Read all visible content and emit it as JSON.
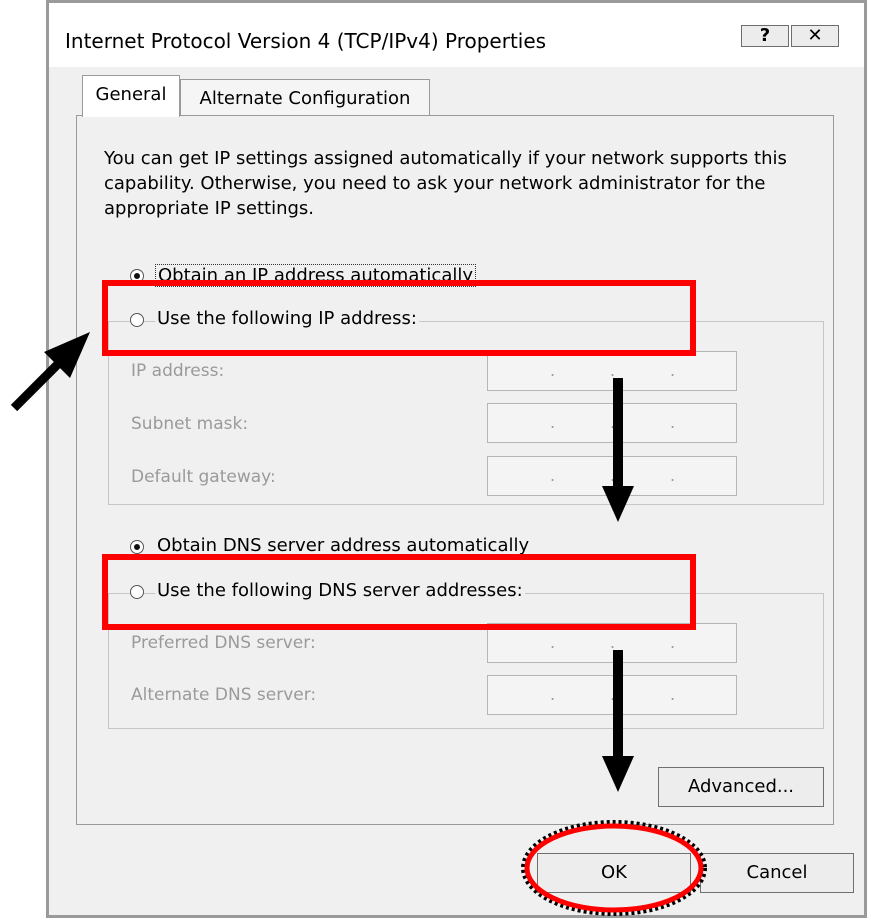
{
  "window": {
    "title": "Internet Protocol Version 4 (TCP/IPv4) Properties",
    "help_label": "?",
    "close_label": "✕"
  },
  "tabs": [
    {
      "label": "General",
      "selected": true
    },
    {
      "label": "Alternate Configuration",
      "selected": false
    }
  ],
  "description": "You can get IP settings assigned automatically if your network supports this capability. Otherwise, you need to ask your network administrator for the appropriate IP settings.",
  "ip_section": {
    "auto_label": "Obtain an IP address automatically",
    "manual_label": "Use the following IP address:",
    "fields": [
      {
        "label": "IP address:",
        "value": ".   .   ."
      },
      {
        "label": "Subnet mask:",
        "value": ".   .   ."
      },
      {
        "label": "Default gateway:",
        "value": ".   .   ."
      }
    ]
  },
  "dns_section": {
    "auto_label": "Obtain DNS server address automatically",
    "manual_label": "Use the following DNS server addresses:",
    "fields": [
      {
        "label": "Preferred DNS server:",
        "value": ".   .   ."
      },
      {
        "label": "Alternate DNS server:",
        "value": ".   .   ."
      }
    ]
  },
  "buttons": {
    "advanced": "Advanced...",
    "ok": "OK",
    "cancel": "Cancel"
  },
  "colors": {
    "highlight": "#ff0000",
    "arrow": "#000000"
  }
}
